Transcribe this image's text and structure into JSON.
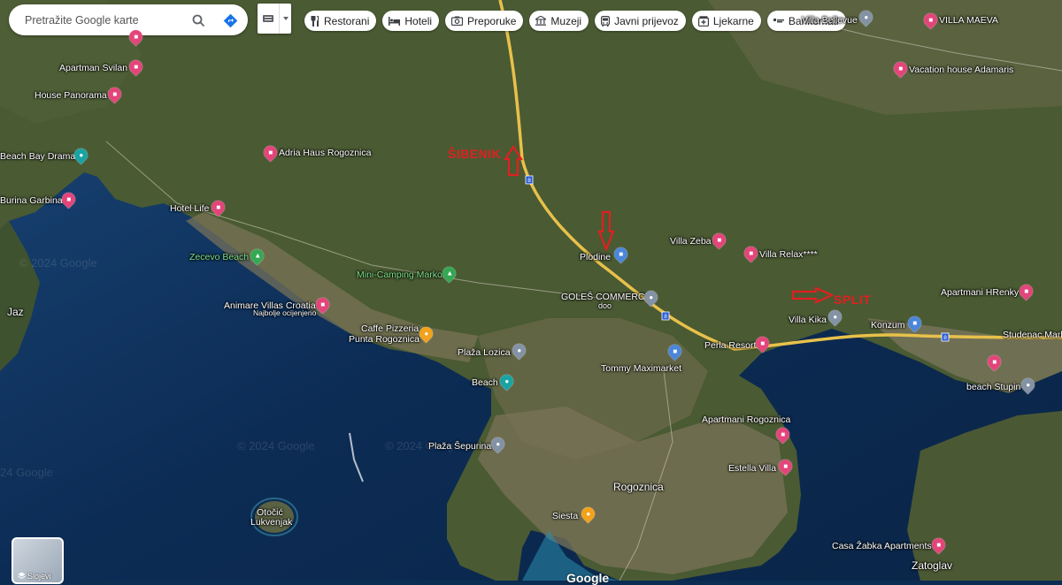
{
  "search": {
    "placeholder": "Pretražite Google karte"
  },
  "chips": [
    {
      "label": "Restorani",
      "icon": "fork-knife-icon"
    },
    {
      "label": "Hoteli",
      "icon": "bed-icon"
    },
    {
      "label": "Preporuke",
      "icon": "camera-icon"
    },
    {
      "label": "Muzeji",
      "icon": "museum-icon"
    },
    {
      "label": "Javni prijevoz",
      "icon": "bus-icon"
    },
    {
      "label": "Ljekarne",
      "icon": "pharmacy-icon"
    },
    {
      "label": "Bankomati",
      "icon": "atm-icon"
    }
  ],
  "places": {
    "villa_bellevue": "Villa Bellevue",
    "villa_maeva": "VILLA MAEVA",
    "apartman_svilan": "Apartman Svilan",
    "vacation_adamaris": "Vacation house Adamaris",
    "house_panorama": "House Panorama",
    "adria_haus": "Adria Haus Rogoznica",
    "beach_bay_dramac": "Beach Bay Dramać",
    "burina_garbina": "Burina Garbina",
    "hotel_life": "Hotel Life",
    "zecevo_beach": "Zecevo Beach",
    "villa_zeba": "Villa Zeba",
    "villa_relax": "Villa Relax****",
    "plodine": "Plodine",
    "mini_camping": "Mini-Camping Marko",
    "goles": "GOLEŠ COMMERCE",
    "goles_sub": "doo",
    "apartmani_hrenky": "Apartmani HRenky",
    "jaz": "Jaz",
    "animare": "Animare Villas Croatia",
    "animare_sub": "Najbolje ocijenjeno",
    "villa_kika": "Villa Kika",
    "konzum": "Konzum",
    "studenac": "Studenac Mark",
    "caffe_pizzeria": "Caffe Pizzeria",
    "caffe_pizzeria_2": "Punta Rogoznica",
    "perla_resort": "Perla Resort",
    "plaza_lozica": "Plaža Lozica",
    "tommy": "Tommy Maximarket",
    "beach": "Beach",
    "beach_stupin": "beach Stupin",
    "apartmani_rogoznica": "Apartmani Rogoznica",
    "plaza_sepurina": "Plaža Šepurina",
    "estella_villa": "Estella Villa",
    "rogoznica": "Rogoznica",
    "siesta": "Siesta",
    "otocic": "Otočić",
    "lukvenjak": "Lukvenjak",
    "casa_zabka": "Casa Žabka Apartments",
    "zatoglav": "Zatoglav"
  },
  "annotations": {
    "sibenik": "ŠIBENIK",
    "split": "SPLIT"
  },
  "road_shields": [
    "8",
    "8",
    "8"
  ],
  "watermarks": [
    "© 2024 Google",
    "© 2024 Google",
    "24 Google",
    "© 2024 Google"
  ],
  "layers_label": "Slojevi",
  "google_logo": "Google",
  "colors": {
    "pin_pink": "#e3457a",
    "pin_blue": "#4b86d9",
    "annotation_red": "#e02020",
    "road_yellow": "#e8c14a"
  }
}
